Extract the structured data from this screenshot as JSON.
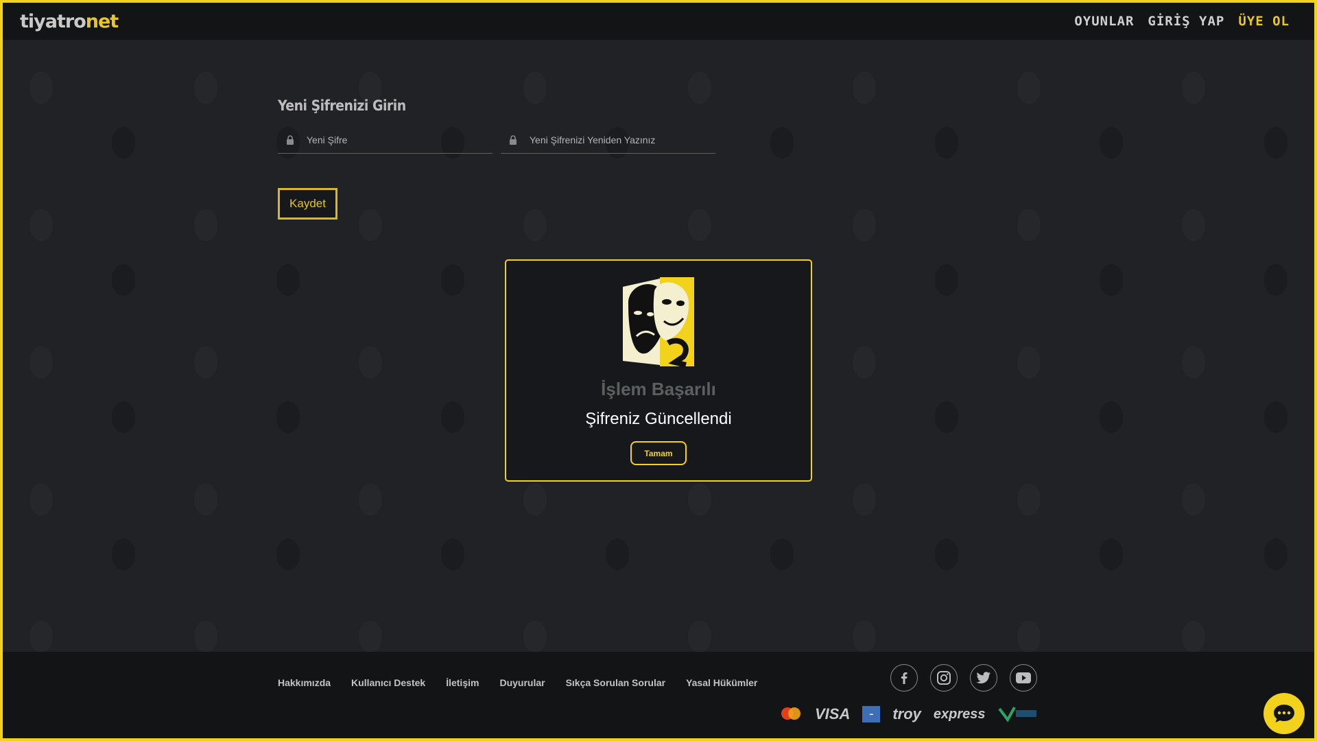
{
  "header": {
    "logo_part1": "tiyatro",
    "logo_part2": "net",
    "nav": {
      "plays": "OYUNLAR",
      "login": "GİRİŞ YAP",
      "signup": "ÜYE OL"
    }
  },
  "form": {
    "title": "Yeni Şifrenizi Girin",
    "new_password_placeholder": "Yeni Şifre",
    "confirm_password_placeholder": "Yeni Şifrenizi Yeniden Yazınız",
    "save_label": "Kaydet"
  },
  "modal": {
    "title": "İşlem Başarılı",
    "message": "Şifreniz Güncellendi",
    "ok_label": "Tamam"
  },
  "footer": {
    "links": {
      "about": "Hakkımızda",
      "support": "Kullanıcı Destek",
      "contact": "İletişim",
      "announcements": "Duyurular",
      "faq": "Sıkça Sorulan Sorular",
      "legal": "Yasal Hükümler"
    },
    "social_icons": [
      "facebook-icon",
      "instagram-icon",
      "twitter-icon",
      "youtube-icon"
    ],
    "payment": {
      "visa": "VISA",
      "troy": "troy",
      "express": "express"
    }
  },
  "colors": {
    "accent": "#f2d21b",
    "background": "#1f2023",
    "header": "#131416"
  }
}
